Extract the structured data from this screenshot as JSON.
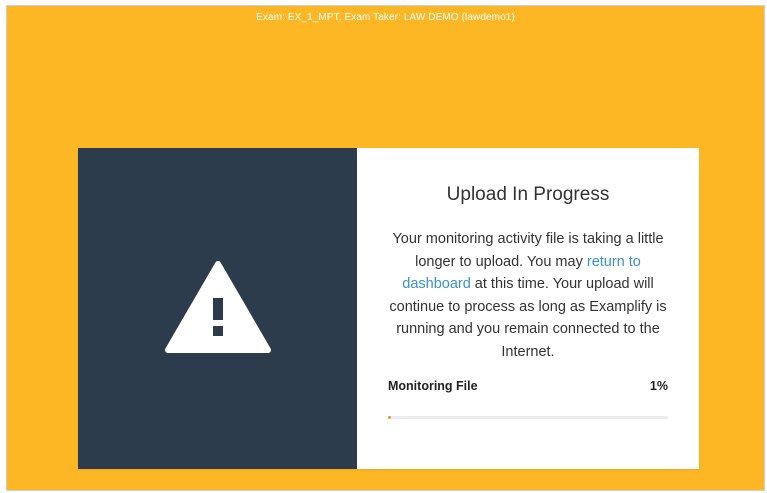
{
  "window": {
    "title": "Exam: EX_1_MPT, Exam Taker: LAW DEMO (lawdemo1)",
    "background_color": "#fdb724"
  },
  "dialog": {
    "icon": "warning-icon",
    "panel_color": "#2d3c4d",
    "title": "Upload In Progress",
    "message_before_link": "Your monitoring activity file is taking a little longer to upload. You may ",
    "link_text": "return to dashboard",
    "message_after_link": " at this time. Your upload will continue to process as long as Examplify is running and you remain connected to the Internet.",
    "progress": {
      "label": "Monitoring File",
      "percent_text": "1%",
      "value": 0.01,
      "fill_color": "#f7931e"
    }
  }
}
